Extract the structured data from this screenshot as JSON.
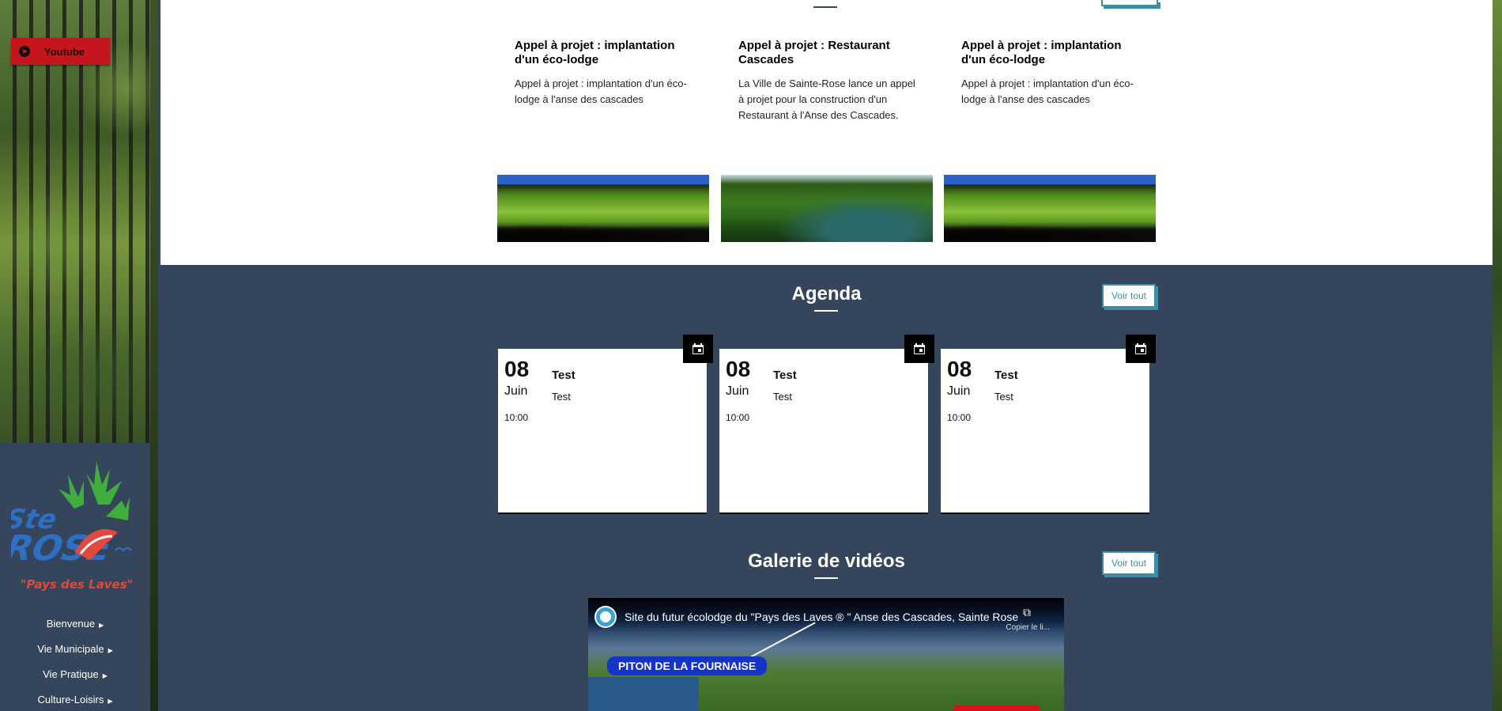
{
  "sidebar": {
    "youtube_label": "Youtube",
    "logo_tagline": "\"Pays des Laves\"",
    "nav": [
      {
        "label": "Bienvenue"
      },
      {
        "label": "Vie Municipale"
      },
      {
        "label": "Vie Pratique"
      },
      {
        "label": "Culture-Loisirs"
      }
    ]
  },
  "news": {
    "cards": [
      {
        "title": "Appel à projet : implantation d'un éco-lodge",
        "text": "Appel à projet : implantation d'un éco-lodge à l'anse des cascades"
      },
      {
        "title": "Appel à projet : Restaurant Cascades",
        "text": "La Ville de Sainte-Rose lance un appel à projet pour la construction d'un Restaurant à l'Anse des Cascades."
      },
      {
        "title": "Appel à projet : implantation d'un éco-lodge",
        "text": "Appel à projet : implantation d'un éco-lodge à l'anse des cascades"
      }
    ]
  },
  "agenda": {
    "title": "Agenda",
    "voir_tout": "Voir tout",
    "events": [
      {
        "day": "08",
        "month": "Juin",
        "time": "10:00",
        "title": "Test",
        "desc": "Test"
      },
      {
        "day": "08",
        "month": "Juin",
        "time": "10:00",
        "title": "Test",
        "desc": "Test"
      },
      {
        "day": "08",
        "month": "Juin",
        "time": "10:00",
        "title": "Test",
        "desc": "Test"
      }
    ]
  },
  "videos": {
    "title": "Galerie de vidéos",
    "voir_tout": "Voir tout",
    "video_title": "Site du futur écolodge du \"Pays des Laves ® \" Anse des Cascades, Sainte Rose",
    "copy_label": "Copier le li...",
    "place_label": "PITON DE LA FOURNAISE"
  },
  "colors": {
    "accent": "#3b8ea5",
    "section_bg": "#35455b",
    "youtube_red": "#c4161c"
  }
}
